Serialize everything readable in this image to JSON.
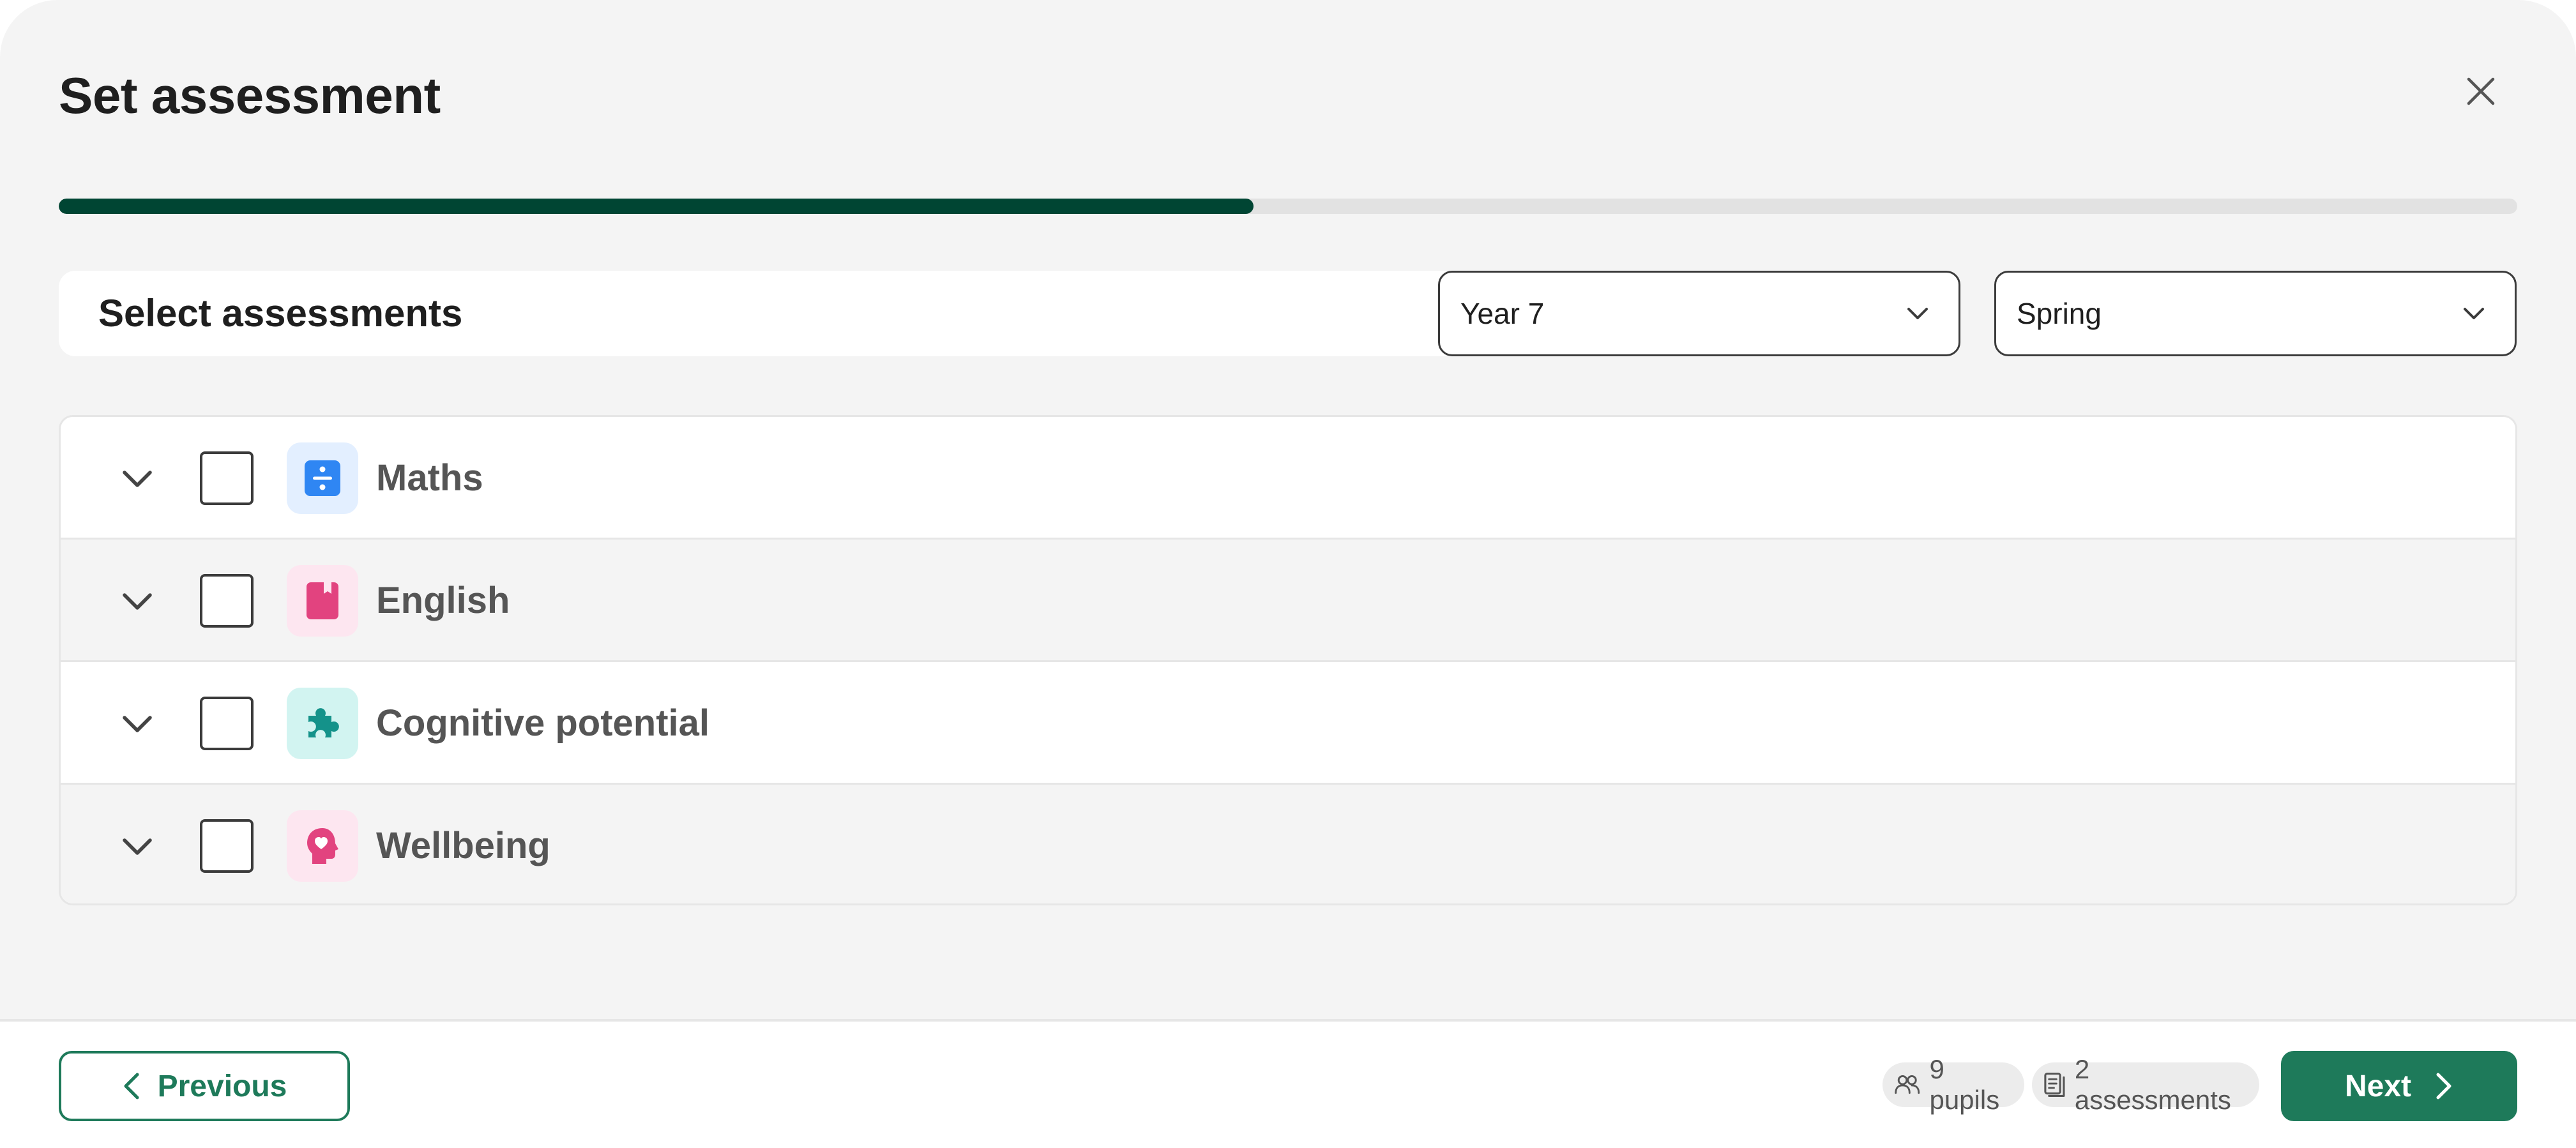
{
  "dialog": {
    "title": "Set assessment",
    "progress_fraction": 0.486,
    "progress_color": "#004533"
  },
  "section": {
    "title": "Select assessments"
  },
  "filters": {
    "year": "Year 7",
    "term": "Spring"
  },
  "subjects": [
    {
      "label": "Maths",
      "icon": "divide-icon",
      "icon_bg": "#e3efff",
      "icon_color": "#2f86f3",
      "checked": false
    },
    {
      "label": "English",
      "icon": "book-icon",
      "icon_bg": "#fde6f0",
      "icon_color": "#e2437f",
      "checked": false
    },
    {
      "label": "Cognitive potential",
      "icon": "puzzle-icon",
      "icon_bg": "#d2f4f1",
      "icon_color": "#14928a",
      "checked": false
    },
    {
      "label": "Wellbeing",
      "icon": "head-heart-icon",
      "icon_bg": "#fde6f0",
      "icon_color": "#e2437f",
      "checked": false
    }
  ],
  "footer": {
    "previous_label": "Previous",
    "pupils": "9 pupils",
    "assessments": "2 assessments",
    "next_label": "Next"
  },
  "colors": {
    "primary": "#1e7a5a",
    "progress": "#004533"
  }
}
